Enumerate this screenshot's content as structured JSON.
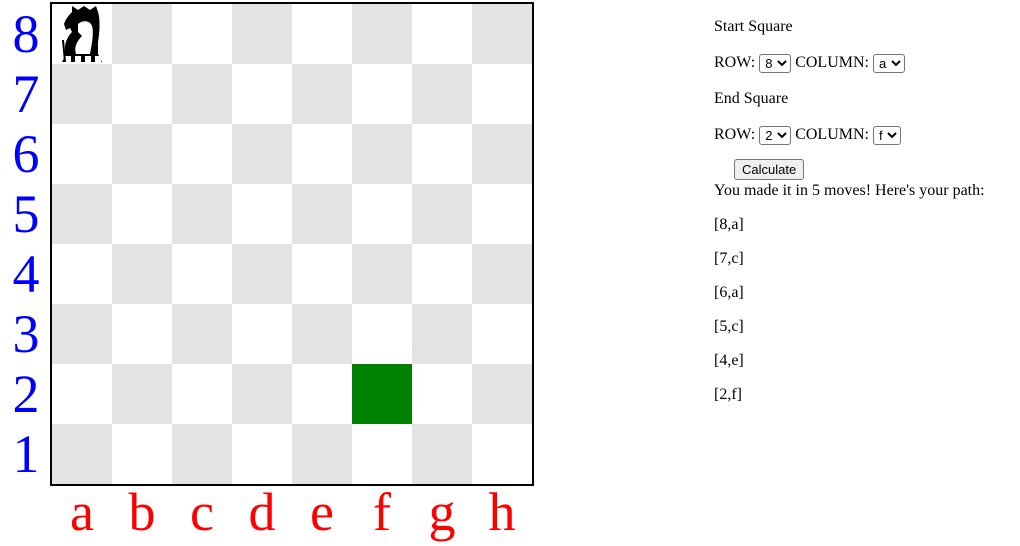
{
  "board": {
    "ranks": [
      "8",
      "7",
      "6",
      "5",
      "4",
      "3",
      "2",
      "1"
    ],
    "files": [
      "a",
      "b",
      "c",
      "d",
      "e",
      "f",
      "g",
      "h"
    ],
    "piece": {
      "icon": "knight-icon",
      "square": "a8"
    },
    "target_square": "f2",
    "colors": {
      "light": "#ffffff",
      "dark": "#e3e3e3",
      "target": "#008000",
      "rank_label": "#0000ff",
      "file_label": "#ff0000"
    }
  },
  "controls": {
    "start_heading": "Start Square",
    "end_heading": "End Square",
    "row_label": "ROW:",
    "column_label": "COLUMN:",
    "start_row": "8",
    "start_column": "a",
    "end_row": "2",
    "end_column": "f",
    "calculate_label": "Calculate"
  },
  "result": {
    "message": "You made it in 5 moves! Here's your path:",
    "path": [
      "[8,a]",
      "[7,c]",
      "[6,a]",
      "[5,c]",
      "[4,e]",
      "[2,f]"
    ]
  }
}
